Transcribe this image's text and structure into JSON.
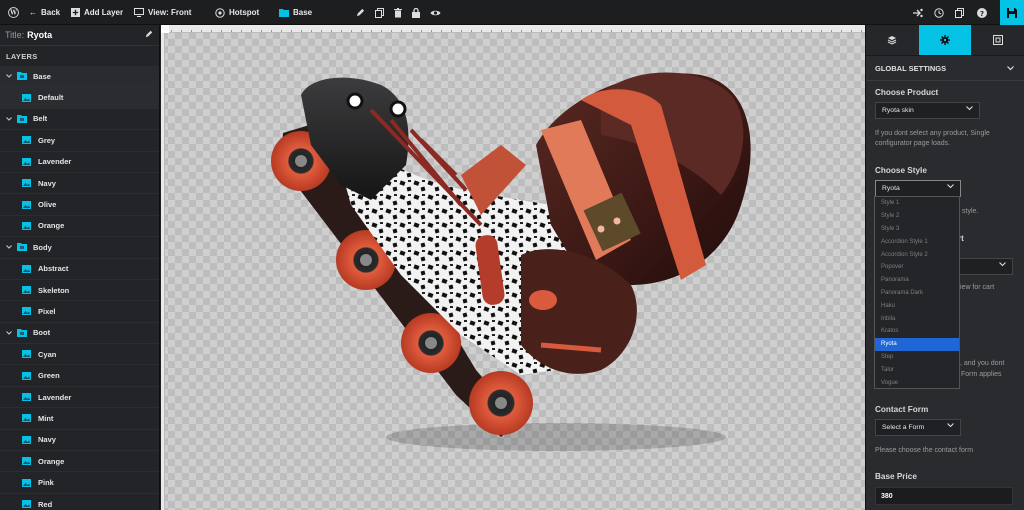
{
  "toolbar": {
    "add_layer": "Add Layer",
    "back": "Back",
    "view": "View: Front",
    "hotspot": "Hotspot",
    "base": "Base"
  },
  "left_panel": {
    "title_label": "Title:",
    "title_value": "Ryota",
    "layers_heading": "LAYERS",
    "rows": [
      {
        "type": "group",
        "label": "Base"
      },
      {
        "type": "child",
        "label": "Default"
      },
      {
        "type": "group",
        "label": "Belt"
      },
      {
        "type": "child",
        "label": "Grey"
      },
      {
        "type": "child",
        "label": "Lavender"
      },
      {
        "type": "child",
        "label": "Navy"
      },
      {
        "type": "child",
        "label": "Olive"
      },
      {
        "type": "child",
        "label": "Orange"
      },
      {
        "type": "group",
        "label": "Body"
      },
      {
        "type": "child",
        "label": "Abstract"
      },
      {
        "type": "child",
        "label": "Skeleton"
      },
      {
        "type": "child",
        "label": "Pixel"
      },
      {
        "type": "group",
        "label": "Boot"
      },
      {
        "type": "child",
        "label": "Cyan"
      },
      {
        "type": "child",
        "label": "Green"
      },
      {
        "type": "child",
        "label": "Lavender"
      },
      {
        "type": "child",
        "label": "Mint"
      },
      {
        "type": "child",
        "label": "Navy"
      },
      {
        "type": "child",
        "label": "Orange"
      },
      {
        "type": "child",
        "label": "Pink"
      },
      {
        "type": "child",
        "label": "Red"
      }
    ]
  },
  "right_panel": {
    "global_settings": "GLOBAL SETTINGS",
    "choose_product": "Choose Product",
    "product_value": "Ryota skin",
    "product_help_1": "If you dont select any product, Single",
    "product_help_2": "configurator page loads.",
    "choose_style": "Choose Style",
    "style_value": "Ryota",
    "style_help_tail": "style.",
    "partial_t": "rt",
    "partial_cart": "iew for cart",
    "partial_dont": ", and you dont",
    "partial_applies": "Form applies",
    "contact_form": "Contact Form",
    "contact_value": "Select a Form",
    "contact_help": "Please choose the contact form",
    "base_price": "Base Price",
    "base_price_value": "380"
  },
  "style_options": [
    "Style 1",
    "Style 2",
    "Style 3",
    "Accordion Style 1",
    "Accordion Style 2",
    "Popover",
    "Panorama",
    "Panorama Dark",
    "Haku",
    "Inbila",
    "Kratos",
    "Ryota",
    "Step",
    "Talor",
    "Vogue"
  ],
  "selected_style": "Ryota",
  "colors": {
    "accent": "#04c2e5",
    "highlight": "#1f66d6",
    "panel": "#232427"
  }
}
